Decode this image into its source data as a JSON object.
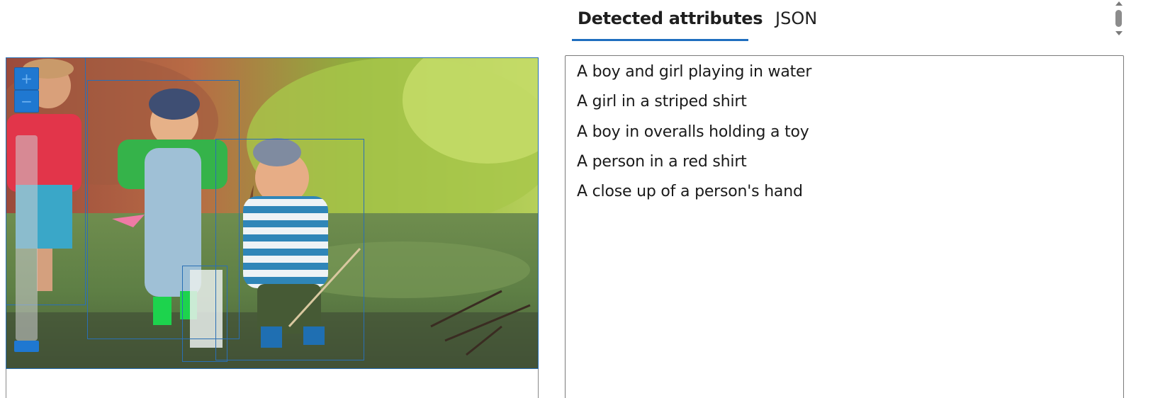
{
  "tabs": [
    {
      "label": "Detected attributes",
      "active": true
    },
    {
      "label": "JSON",
      "active": false
    }
  ],
  "attributes": [
    "A boy and girl playing in water",
    "A girl in a striped shirt",
    "A boy in overalls holding a toy",
    "A person in a red shirt",
    "A close up of a person's hand"
  ],
  "zoom": {
    "in_label": "+",
    "out_label": "−"
  },
  "icons": {
    "zoom_in": "plus-icon",
    "zoom_out": "minus-icon",
    "scroll_up": "triangle-up-icon",
    "scroll_down": "triangle-down-icon"
  },
  "colors": {
    "accent": "#1f6ebf",
    "bbox": "#2a6fb5",
    "zoom_button": "#1f78d1"
  }
}
